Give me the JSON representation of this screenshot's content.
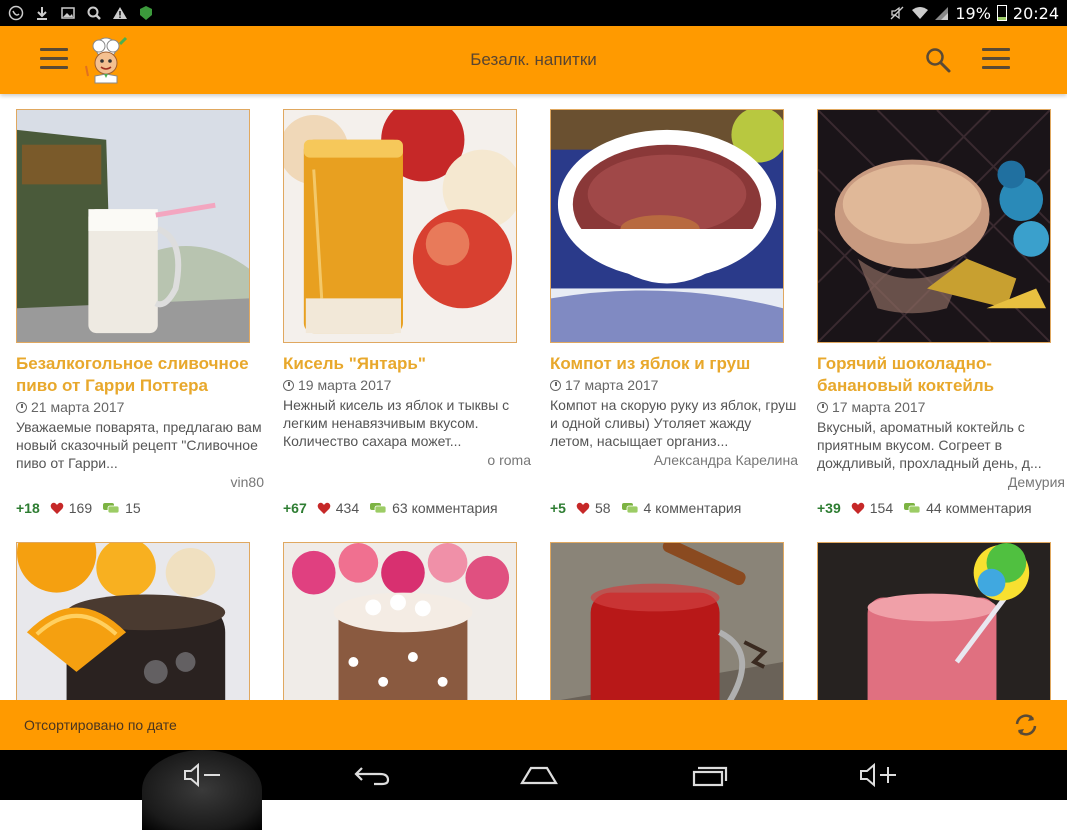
{
  "status_bar": {
    "battery_percent": "19%",
    "time": "20:24",
    "icons": [
      "viber-icon",
      "download-icon",
      "image-icon",
      "search-icon",
      "warning-icon",
      "android-icon",
      "mute-icon",
      "wifi-icon",
      "signal-icon",
      "battery-icon"
    ]
  },
  "appbar": {
    "title": "Безалк. напитки",
    "icons": [
      "menu-icon",
      "chef-logo",
      "search-icon",
      "more-icon"
    ]
  },
  "cards": [
    {
      "title": "Безалкогольное сливочное пиво от Гарри Поттера",
      "date": "21 марта 2017",
      "desc": "Уважаемые поварята, предлагаю вам новый сказочный рецепт \"Сливочное пиво от Гарри...",
      "author": "vin80",
      "rating": "+18",
      "likes": "169",
      "comments": "15"
    },
    {
      "title": "Кисель \"Янтарь\"",
      "date": "19 марта 2017",
      "desc": "Нежный кисель из яблок и тыквы с легким ненавязчивым вкусом. Количество сахара может...",
      "author": "o roma",
      "rating": "+67",
      "likes": "434",
      "comments": "63 комментария"
    },
    {
      "title": "Компот из яблок и груш",
      "date": "17 марта 2017",
      "desc": "Компот на скорую руку из яблок, груш и одной сливы) Утоляет жажду летом, насыщает организ...",
      "author": "Александра Карелина",
      "rating": "+5",
      "likes": "58",
      "comments": "4 комментария"
    },
    {
      "title": "Горячий шоколадно-банановый коктейль",
      "date": "17 марта 2017",
      "desc": "Вкусный, ароматный коктейль с приятным вкусом. Согреет в дождливый, прохладный день, д...",
      "author": "Демурия",
      "rating": "+39",
      "likes": "154",
      "comments": "44 комментария"
    }
  ],
  "sortbar": {
    "label": "Отсортировано по дате"
  },
  "colors": {
    "accent": "#ff9a00",
    "title": "#e8a82c",
    "rating": "#2e7d32"
  }
}
